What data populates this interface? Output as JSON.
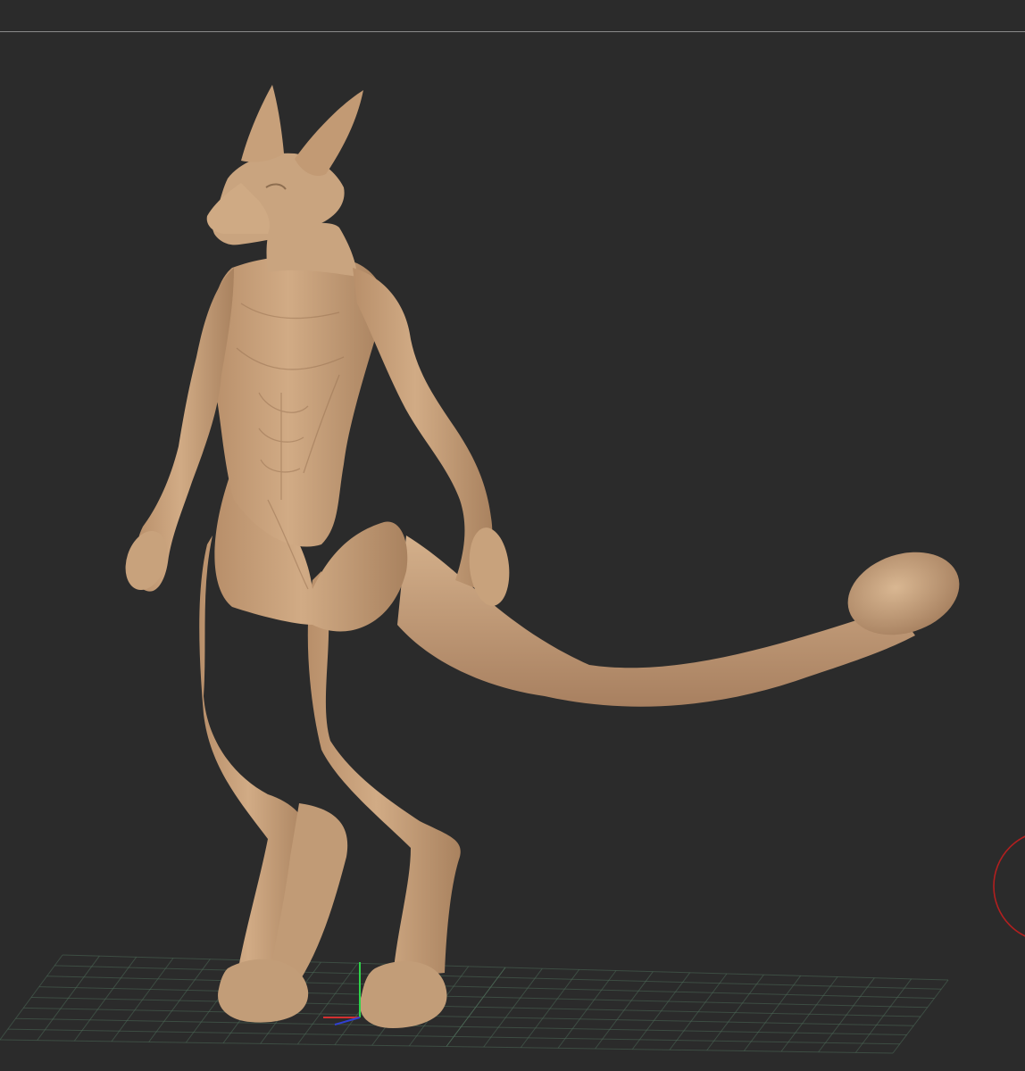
{
  "viewport": {
    "background_color": "#2b2b2b",
    "divider_color": "#8a8a8a"
  },
  "model": {
    "material_color": "#c8a27c",
    "shadow_color": "#8e6e50",
    "highlight_color": "#dbb994"
  },
  "floor_grid": {
    "line_color": "#4d6a58"
  },
  "axis_gizmo": {
    "x_color": "#d23030",
    "y_color": "#2fd24a",
    "z_color": "#3040d2"
  },
  "navigation_gizmo": {
    "ring_color": "#b21f1f"
  },
  "icons": {
    "rotate_gizmo": "rotate-ring-icon",
    "axis_tripod": "axis-tripod-icon"
  }
}
